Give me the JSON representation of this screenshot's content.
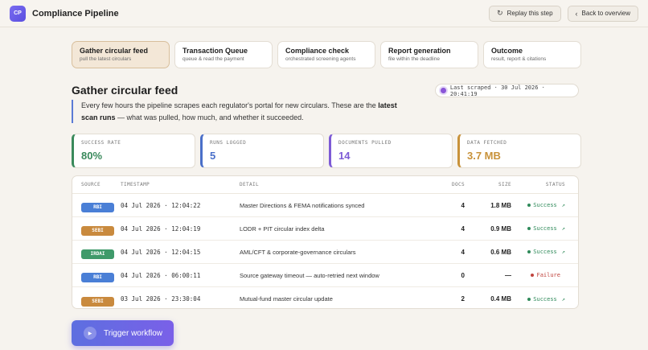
{
  "app": {
    "logo_text": "CP",
    "title": "Compliance Pipeline"
  },
  "header": {
    "replay_label": "Replay this step",
    "back_label": "Back to overview"
  },
  "steps": [
    {
      "title": "Gather circular feed",
      "subtitle": "pull the latest circulars",
      "active": true
    },
    {
      "title": "Transaction Queue",
      "subtitle": "queue & read the payment"
    },
    {
      "title": "Compliance check",
      "subtitle": "orchestrated screening agents"
    },
    {
      "title": "Report generation",
      "subtitle": "file within the deadline"
    },
    {
      "title": "Outcome",
      "subtitle": "result, report & citations"
    }
  ],
  "section": {
    "title": "Gather circular feed",
    "last_scraped": "Last scraped · 30 Jul 2026 · 20:41:19",
    "desc_1": "Every few hours the pipeline scrapes each regulator's portal for new circulars. These are the ",
    "desc_bold": "latest scan runs",
    "desc_2": " — what was pulled, how much, and whether it succeeded."
  },
  "stats": [
    {
      "label": "SUCCESS RATE",
      "value": "80%",
      "color": "#3a8a5c"
    },
    {
      "label": "RUNS LOGGED",
      "value": "5",
      "color": "#4a6fc9"
    },
    {
      "label": "DOCUMENTS PULLED",
      "value": "14",
      "color": "#7d5bd6"
    },
    {
      "label": "DATA FETCHED",
      "value": "3.7 MB",
      "color": "#c8923a"
    }
  ],
  "table": {
    "headers": {
      "source": "SOURCE",
      "timestamp": "TIMESTAMP",
      "detail": "DETAIL",
      "docs": "DOCS",
      "size": "SIZE",
      "status": "STATUS"
    },
    "rows": [
      {
        "source": "RBI",
        "source_color": "#4a7fd6",
        "timestamp": "04 Jul 2026 · 12:04:22",
        "detail": "Master Directions & FEMA notifications synced",
        "docs": "4",
        "size": "1.8 MB",
        "status": "Success",
        "status_color": "#2f8a5a",
        "ext": "↗"
      },
      {
        "source": "SEBI",
        "source_color": "#c98a3e",
        "timestamp": "04 Jul 2026 · 12:04:19",
        "detail": "LODR + PIT circular index delta",
        "docs": "4",
        "size": "0.9 MB",
        "status": "Success",
        "status_color": "#2f8a5a",
        "ext": "↗"
      },
      {
        "source": "IRDAI",
        "source_color": "#3f9a6a",
        "timestamp": "04 Jul 2026 · 12:04:15",
        "detail": "AML/CFT & corporate-governance circulars",
        "docs": "4",
        "size": "0.6 MB",
        "status": "Success",
        "status_color": "#2f8a5a",
        "ext": "↗"
      },
      {
        "source": "RBI",
        "source_color": "#4a7fd6",
        "timestamp": "04 Jul 2026 · 06:00:11",
        "detail": "Source gateway timeout — auto-retried next window",
        "docs": "0",
        "size": "—",
        "status": "Failure",
        "status_color": "#c0453f",
        "ext": ""
      },
      {
        "source": "SEBI",
        "source_color": "#c98a3e",
        "timestamp": "03 Jul 2026 · 23:30:04",
        "detail": "Mutual-fund master circular update",
        "docs": "2",
        "size": "0.4 MB",
        "status": "Success",
        "status_color": "#2f8a5a",
        "ext": "↗"
      }
    ]
  },
  "trigger": {
    "label": "Trigger workflow"
  }
}
